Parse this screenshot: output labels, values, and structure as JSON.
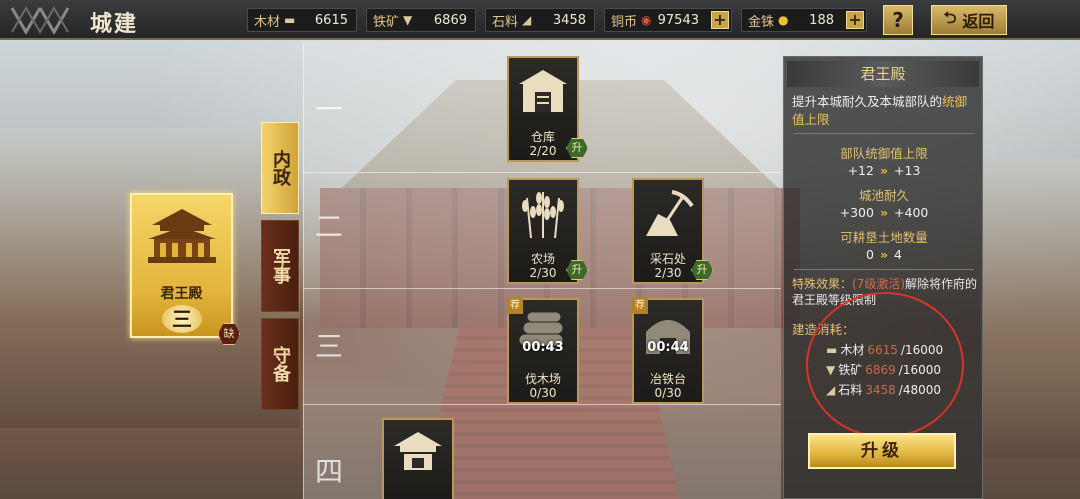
{
  "header": {
    "title": "城建",
    "help": "?",
    "back_label": "返回"
  },
  "resources": [
    {
      "label": "木材",
      "icon": "wood-icon",
      "value": "6615"
    },
    {
      "label": "铁矿",
      "icon": "iron-icon",
      "value": "6869"
    },
    {
      "label": "石料",
      "icon": "stone-icon",
      "value": "3458"
    },
    {
      "label": "铜币",
      "icon": "coin-icon",
      "value": "97543"
    },
    {
      "label": "金铢",
      "icon": "gold-icon",
      "value": "188"
    }
  ],
  "selected": {
    "name": "君王殿",
    "level": "三",
    "missing": "缺"
  },
  "tabs": [
    {
      "label": "内政"
    },
    {
      "label": "军事"
    },
    {
      "label": "守备"
    }
  ],
  "tiers": [
    "一",
    "二",
    "三",
    "四"
  ],
  "buildings": [
    {
      "name": "仓库",
      "level": "2/20",
      "upgrade": "升"
    },
    {
      "name": "农场",
      "level": "2/30",
      "upgrade": "升"
    },
    {
      "name": "采石处",
      "level": "2/30",
      "upgrade": "升"
    },
    {
      "name": "伐木场",
      "level": "0/30",
      "timer": "00:43",
      "recommend": "荐"
    },
    {
      "name": "冶铁台",
      "level": "0/30",
      "timer": "00:44",
      "recommend": "荐"
    }
  ],
  "info": {
    "title": "君王殿",
    "desc_prefix": "提升本城耐久及本城部队的",
    "desc_highlight": "统御值上限",
    "stats": [
      {
        "label": "部队统御值上限",
        "from": "+12",
        "to": "+13"
      },
      {
        "label": "城池耐久",
        "from": "+300",
        "to": "+400"
      },
      {
        "label": "可耕垦土地数量",
        "from": "0",
        "to": "4"
      }
    ],
    "special_label": "特殊效果：",
    "special_act": "(7级激活)",
    "special_text": "解除将作府的君王殿等级限制",
    "cost_label": "建造消耗：",
    "costs": [
      {
        "name": "木材",
        "have": "6615",
        "need": "/16000"
      },
      {
        "name": "铁矿",
        "have": "6869",
        "need": "/16000"
      },
      {
        "name": "石料",
        "have": "3458",
        "need": "/48000"
      }
    ],
    "upgrade_label": "升级"
  }
}
